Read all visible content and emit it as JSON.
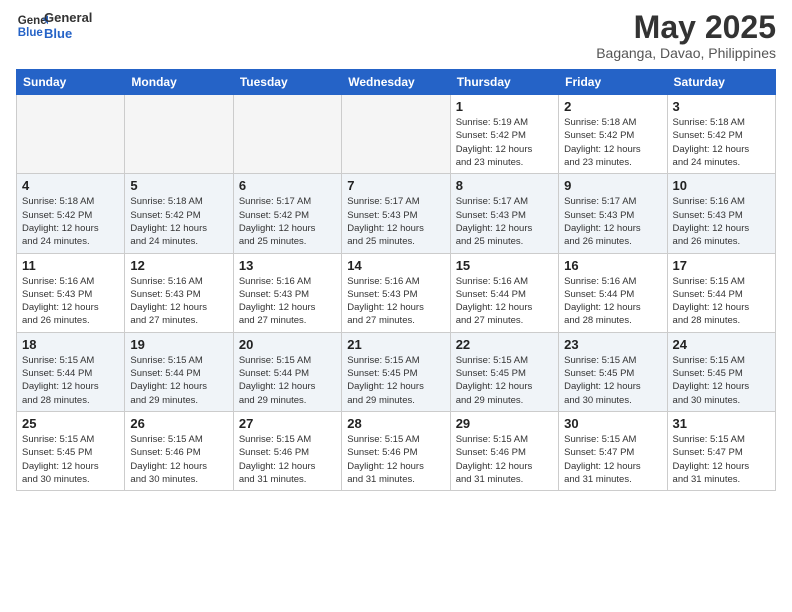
{
  "logo": {
    "line1": "General",
    "line2": "Blue"
  },
  "title": "May 2025",
  "location": "Baganga, Davao, Philippines",
  "weekdays": [
    "Sunday",
    "Monday",
    "Tuesday",
    "Wednesday",
    "Thursday",
    "Friday",
    "Saturday"
  ],
  "weeks": [
    [
      {
        "day": "",
        "info": ""
      },
      {
        "day": "",
        "info": ""
      },
      {
        "day": "",
        "info": ""
      },
      {
        "day": "",
        "info": ""
      },
      {
        "day": "1",
        "info": "Sunrise: 5:19 AM\nSunset: 5:42 PM\nDaylight: 12 hours\nand 23 minutes."
      },
      {
        "day": "2",
        "info": "Sunrise: 5:18 AM\nSunset: 5:42 PM\nDaylight: 12 hours\nand 23 minutes."
      },
      {
        "day": "3",
        "info": "Sunrise: 5:18 AM\nSunset: 5:42 PM\nDaylight: 12 hours\nand 24 minutes."
      }
    ],
    [
      {
        "day": "4",
        "info": "Sunrise: 5:18 AM\nSunset: 5:42 PM\nDaylight: 12 hours\nand 24 minutes."
      },
      {
        "day": "5",
        "info": "Sunrise: 5:18 AM\nSunset: 5:42 PM\nDaylight: 12 hours\nand 24 minutes."
      },
      {
        "day": "6",
        "info": "Sunrise: 5:17 AM\nSunset: 5:42 PM\nDaylight: 12 hours\nand 25 minutes."
      },
      {
        "day": "7",
        "info": "Sunrise: 5:17 AM\nSunset: 5:43 PM\nDaylight: 12 hours\nand 25 minutes."
      },
      {
        "day": "8",
        "info": "Sunrise: 5:17 AM\nSunset: 5:43 PM\nDaylight: 12 hours\nand 25 minutes."
      },
      {
        "day": "9",
        "info": "Sunrise: 5:17 AM\nSunset: 5:43 PM\nDaylight: 12 hours\nand 26 minutes."
      },
      {
        "day": "10",
        "info": "Sunrise: 5:16 AM\nSunset: 5:43 PM\nDaylight: 12 hours\nand 26 minutes."
      }
    ],
    [
      {
        "day": "11",
        "info": "Sunrise: 5:16 AM\nSunset: 5:43 PM\nDaylight: 12 hours\nand 26 minutes."
      },
      {
        "day": "12",
        "info": "Sunrise: 5:16 AM\nSunset: 5:43 PM\nDaylight: 12 hours\nand 27 minutes."
      },
      {
        "day": "13",
        "info": "Sunrise: 5:16 AM\nSunset: 5:43 PM\nDaylight: 12 hours\nand 27 minutes."
      },
      {
        "day": "14",
        "info": "Sunrise: 5:16 AM\nSunset: 5:43 PM\nDaylight: 12 hours\nand 27 minutes."
      },
      {
        "day": "15",
        "info": "Sunrise: 5:16 AM\nSunset: 5:44 PM\nDaylight: 12 hours\nand 27 minutes."
      },
      {
        "day": "16",
        "info": "Sunrise: 5:16 AM\nSunset: 5:44 PM\nDaylight: 12 hours\nand 28 minutes."
      },
      {
        "day": "17",
        "info": "Sunrise: 5:15 AM\nSunset: 5:44 PM\nDaylight: 12 hours\nand 28 minutes."
      }
    ],
    [
      {
        "day": "18",
        "info": "Sunrise: 5:15 AM\nSunset: 5:44 PM\nDaylight: 12 hours\nand 28 minutes."
      },
      {
        "day": "19",
        "info": "Sunrise: 5:15 AM\nSunset: 5:44 PM\nDaylight: 12 hours\nand 29 minutes."
      },
      {
        "day": "20",
        "info": "Sunrise: 5:15 AM\nSunset: 5:44 PM\nDaylight: 12 hours\nand 29 minutes."
      },
      {
        "day": "21",
        "info": "Sunrise: 5:15 AM\nSunset: 5:45 PM\nDaylight: 12 hours\nand 29 minutes."
      },
      {
        "day": "22",
        "info": "Sunrise: 5:15 AM\nSunset: 5:45 PM\nDaylight: 12 hours\nand 29 minutes."
      },
      {
        "day": "23",
        "info": "Sunrise: 5:15 AM\nSunset: 5:45 PM\nDaylight: 12 hours\nand 30 minutes."
      },
      {
        "day": "24",
        "info": "Sunrise: 5:15 AM\nSunset: 5:45 PM\nDaylight: 12 hours\nand 30 minutes."
      }
    ],
    [
      {
        "day": "25",
        "info": "Sunrise: 5:15 AM\nSunset: 5:45 PM\nDaylight: 12 hours\nand 30 minutes."
      },
      {
        "day": "26",
        "info": "Sunrise: 5:15 AM\nSunset: 5:46 PM\nDaylight: 12 hours\nand 30 minutes."
      },
      {
        "day": "27",
        "info": "Sunrise: 5:15 AM\nSunset: 5:46 PM\nDaylight: 12 hours\nand 31 minutes."
      },
      {
        "day": "28",
        "info": "Sunrise: 5:15 AM\nSunset: 5:46 PM\nDaylight: 12 hours\nand 31 minutes."
      },
      {
        "day": "29",
        "info": "Sunrise: 5:15 AM\nSunset: 5:46 PM\nDaylight: 12 hours\nand 31 minutes."
      },
      {
        "day": "30",
        "info": "Sunrise: 5:15 AM\nSunset: 5:47 PM\nDaylight: 12 hours\nand 31 minutes."
      },
      {
        "day": "31",
        "info": "Sunrise: 5:15 AM\nSunset: 5:47 PM\nDaylight: 12 hours\nand 31 minutes."
      }
    ]
  ]
}
